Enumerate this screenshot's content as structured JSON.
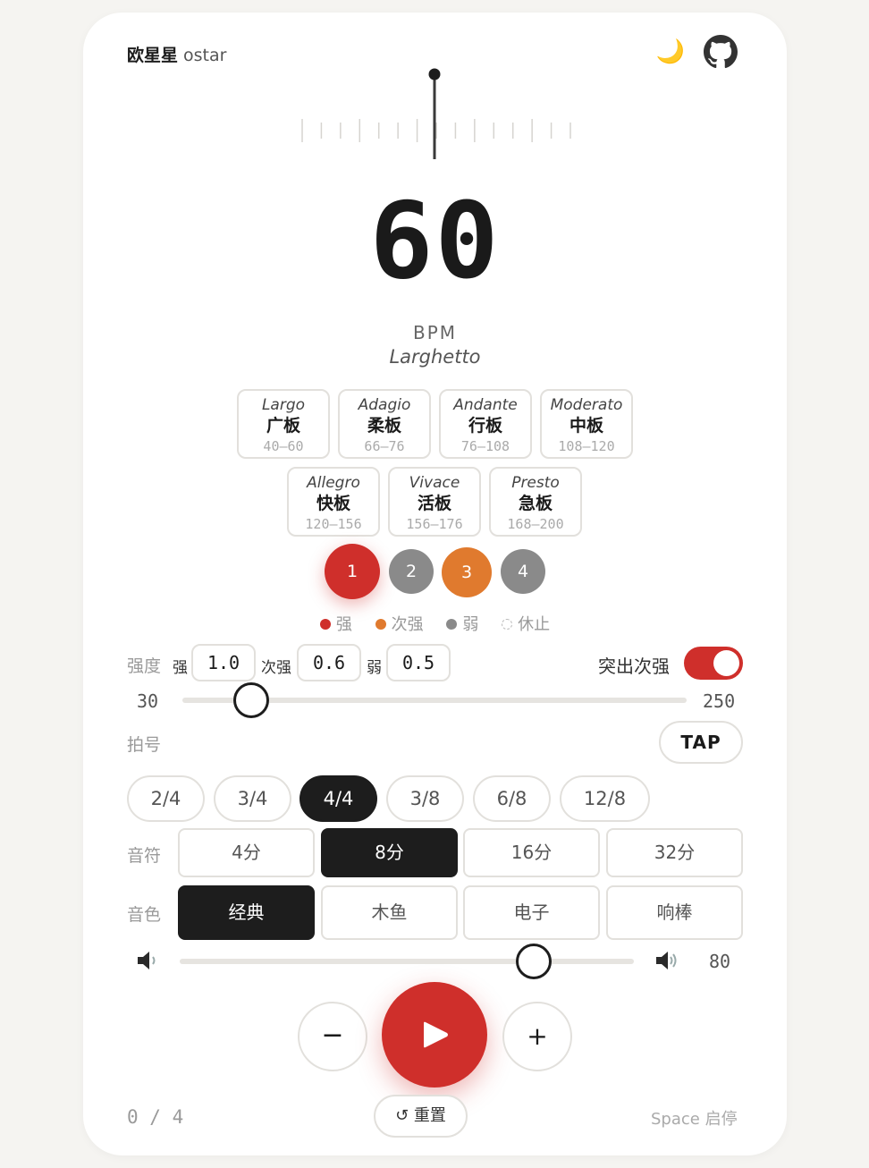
{
  "header": {
    "brand_zh": "欧星星",
    "brand_en": "ostar",
    "theme_icon": "moon-icon",
    "github_icon": "github-icon"
  },
  "bpm": {
    "value": "60",
    "unit": "BPM",
    "tempo_name": "Larghetto",
    "min_label": "30",
    "max_label": "250",
    "value_fraction": 0.136
  },
  "tempos": [
    {
      "en": "Largo",
      "zh": "广板",
      "range": "40–60"
    },
    {
      "en": "Adagio",
      "zh": "柔板",
      "range": "66–76"
    },
    {
      "en": "Andante",
      "zh": "行板",
      "range": "76–108"
    },
    {
      "en": "Moderato",
      "zh": "中板",
      "range": "108–120"
    },
    {
      "en": "Allegro",
      "zh": "快板",
      "range": "120–156"
    },
    {
      "en": "Vivace",
      "zh": "活板",
      "range": "156–176"
    },
    {
      "en": "Presto",
      "zh": "急板",
      "range": "168–200"
    }
  ],
  "beats": [
    {
      "label": "1",
      "type": "strong",
      "color": "#cf2f2b"
    },
    {
      "label": "2",
      "type": "weak",
      "color": "#8a8a8a"
    },
    {
      "label": "3",
      "type": "medium",
      "color": "#e07a2e"
    },
    {
      "label": "4",
      "type": "weak",
      "color": "#8a8a8a"
    }
  ],
  "legend": {
    "strong": "强",
    "medium": "次强",
    "weak": "弱",
    "rest": "休止"
  },
  "intensity": {
    "label": "强度",
    "strong_label": "强",
    "strong_value": "1.0",
    "medium_label": "次强",
    "medium_value": "0.6",
    "weak_label": "弱",
    "weak_value": "0.5",
    "accent_toggle_label": "突出次强",
    "accent_toggle_on": true
  },
  "time_signature": {
    "label": "拍号",
    "tap_label": "TAP",
    "options": [
      "2/4",
      "3/4",
      "4/4",
      "3/8",
      "6/8",
      "12/8"
    ],
    "selected": "4/4"
  },
  "note": {
    "label": "音符",
    "options": [
      "4分",
      "8分",
      "16分",
      "32分"
    ],
    "selected": "8分"
  },
  "sound": {
    "label": "音色",
    "options": [
      "经典",
      "木鱼",
      "电子",
      "响棒"
    ],
    "selected": "经典"
  },
  "volume": {
    "value": "80",
    "fraction": 0.78,
    "low_icon": "speaker-low-icon",
    "high_icon": "speaker-high-icon"
  },
  "controls": {
    "minus": "−",
    "plus": "+",
    "play_icon": "play-icon"
  },
  "footer": {
    "counter": "0 / 4",
    "reset_label": "重置",
    "reset_icon": "reset-icon",
    "shortcut_hint": "Space 启停"
  },
  "colors": {
    "accent_red": "#cf2f2b",
    "accent_orange": "#e07a2e",
    "weak_gray": "#8a8a8a",
    "dark": "#1d1d1d"
  }
}
